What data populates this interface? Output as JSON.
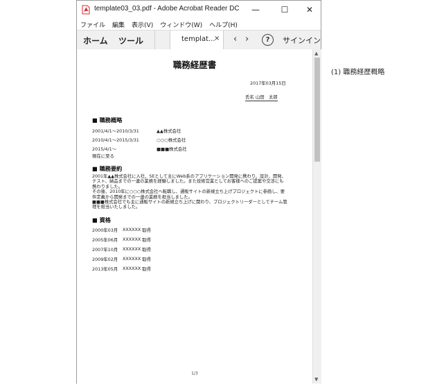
{
  "window": {
    "title": "template03_03.pdf - Adobe Acrobat Reader DC",
    "minimize": "—",
    "maximize": "☐",
    "close": "✕"
  },
  "menu": [
    "ファイル",
    "編集",
    "表示(V)",
    "ウィンドウ(W)",
    "ヘルプ(H)"
  ],
  "toolbar": {
    "home": "ホーム",
    "tools": "ツール",
    "tab_label": "templat...",
    "tab_close": "×",
    "prev": "‹",
    "next": "›",
    "help": "?",
    "signin": "サインイン"
  },
  "document": {
    "title": "職務経歴書",
    "date": "2017年03月15日",
    "name": "氏名 山田　太郎",
    "career_heading": "■ 職務概略",
    "career": [
      {
        "period": "2001/4/1～2010/3/31",
        "company": "▲▲株式会社"
      },
      {
        "period": "2010/4/1～2015/3/31",
        "company": "○○○株式会社"
      },
      {
        "period": "2015/4/1～",
        "company": "■■■株式会社"
      },
      {
        "period": "現在に至る",
        "company": ""
      }
    ],
    "summary_heading": "■ 職務要約",
    "summary": [
      "2001年▲▲株式会社に入社、SEとして主にWeb系のアプリケーション開発に携わり、設計、開発、テスト、納品までの一連の業務を経験しました。また技術営業としてお客様へのご提案や交渉にも携わりました。",
      "その後、2010年に○○○株式会社へ転職し、通販サイトの新規立ち上げプロジェクトに参画し、要件定義から開発までの一連の業務を担当しました。",
      "■■■株式会社でも主に通販サイトの新規立ち上げに関わり、プロジェクトリーダーとしてチーム管理を担当いたしました。"
    ],
    "license_heading": "■ 資格",
    "licenses": [
      {
        "date": "2000年03月",
        "name": "XXXXXX",
        "status": "取得"
      },
      {
        "date": "2005年06月",
        "name": "XXXXXX",
        "status": "取得"
      },
      {
        "date": "2007年10月",
        "name": "XXXXXX",
        "status": "取得"
      },
      {
        "date": "2009年02月",
        "name": "XXXXXX",
        "status": "取得"
      },
      {
        "date": "2013年05月",
        "name": "XXXXXX",
        "status": "取得"
      }
    ],
    "page": "1/3"
  },
  "caption": "(1) 職務経歴概略",
  "colors": {
    "pdf_red": "#d6282b",
    "toolbar_bg": "#f0f0f0",
    "scroll_thumb": "#c1c1c1"
  }
}
